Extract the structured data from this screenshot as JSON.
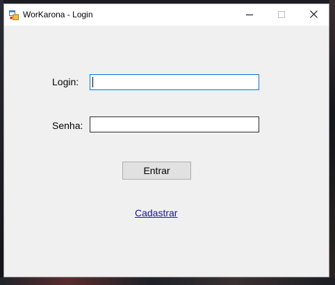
{
  "window": {
    "title": "WorKarona - Login",
    "icon": "windows-forms-app-icon",
    "controls": [
      "minimize-icon",
      "maximize-icon",
      "close-icon"
    ]
  },
  "form": {
    "login_label": "Login:",
    "login_value": "",
    "senha_label": "Senha:",
    "senha_value": "",
    "entrar_label": "Entrar",
    "cadastrar_label": "Cadastrar"
  },
  "colors": {
    "window_background": "#f0f0f0",
    "focused_border": "#0078d7",
    "link": "#1a0dab",
    "button_background": "#e1e1e1"
  }
}
